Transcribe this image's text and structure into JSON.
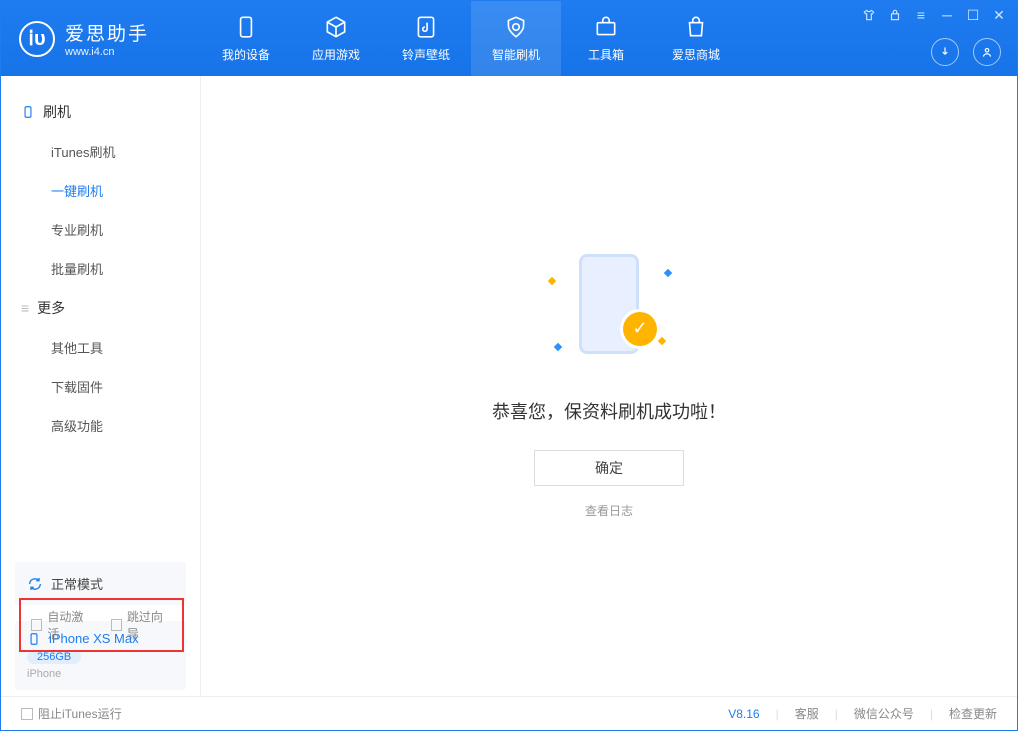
{
  "app": {
    "title": "爱思助手",
    "url": "www.i4.cn"
  },
  "nav": [
    {
      "label": "我的设备"
    },
    {
      "label": "应用游戏"
    },
    {
      "label": "铃声壁纸"
    },
    {
      "label": "智能刷机"
    },
    {
      "label": "工具箱"
    },
    {
      "label": "爱思商城"
    }
  ],
  "sidebar": {
    "group1": {
      "title": "刷机",
      "items": [
        "iTunes刷机",
        "一键刷机",
        "专业刷机",
        "批量刷机"
      ]
    },
    "group2": {
      "title": "更多",
      "items": [
        "其他工具",
        "下载固件",
        "高级功能"
      ]
    }
  },
  "mode": {
    "label": "正常模式"
  },
  "device": {
    "name": "iPhone XS Max",
    "storage": "256GB",
    "type": "iPhone"
  },
  "main": {
    "success": "恭喜您，保资料刷机成功啦！",
    "confirm": "确定",
    "view_log": "查看日志"
  },
  "checks": {
    "auto_activate": "自动激活",
    "skip_guide": "跳过向导"
  },
  "footer": {
    "block_itunes": "阻止iTunes运行",
    "version": "V8.16",
    "support": "客服",
    "wechat": "微信公众号",
    "update": "检查更新"
  }
}
